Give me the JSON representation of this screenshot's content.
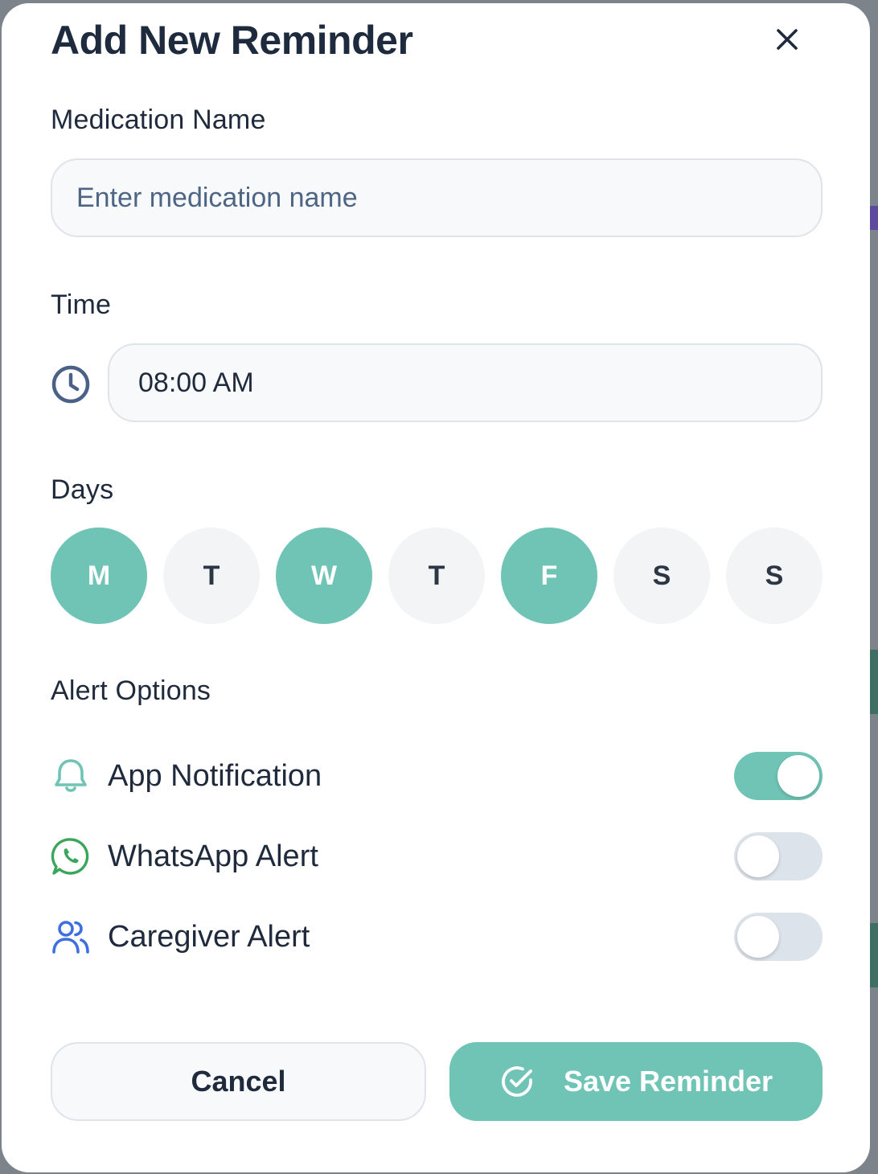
{
  "modal": {
    "title": "Add New Reminder",
    "close_icon": "close-icon"
  },
  "medication": {
    "label": "Medication Name",
    "placeholder": "Enter medication name",
    "value": ""
  },
  "time": {
    "label": "Time",
    "icon": "clock-icon",
    "value": "08:00 AM"
  },
  "days": {
    "label": "Days",
    "items": [
      {
        "letter": "M",
        "selected": true
      },
      {
        "letter": "T",
        "selected": false
      },
      {
        "letter": "W",
        "selected": true
      },
      {
        "letter": "T",
        "selected": false
      },
      {
        "letter": "F",
        "selected": true
      },
      {
        "letter": "S",
        "selected": false
      },
      {
        "letter": "S",
        "selected": false
      }
    ]
  },
  "alerts": {
    "label": "Alert Options",
    "items": [
      {
        "label": "App Notification",
        "icon": "bell-icon",
        "enabled": true
      },
      {
        "label": "WhatsApp Alert",
        "icon": "whatsapp-icon",
        "enabled": false
      },
      {
        "label": "Caregiver Alert",
        "icon": "users-icon",
        "enabled": false
      }
    ]
  },
  "actions": {
    "cancel_label": "Cancel",
    "save_label": "Save Reminder",
    "save_icon": "check-circle-icon"
  },
  "colors": {
    "accent": "#6fc4b6",
    "text": "#1f2a3c",
    "muted_icon": "#4a6288",
    "whatsapp": "#3aa65b",
    "caregiver": "#3d6fe0"
  }
}
